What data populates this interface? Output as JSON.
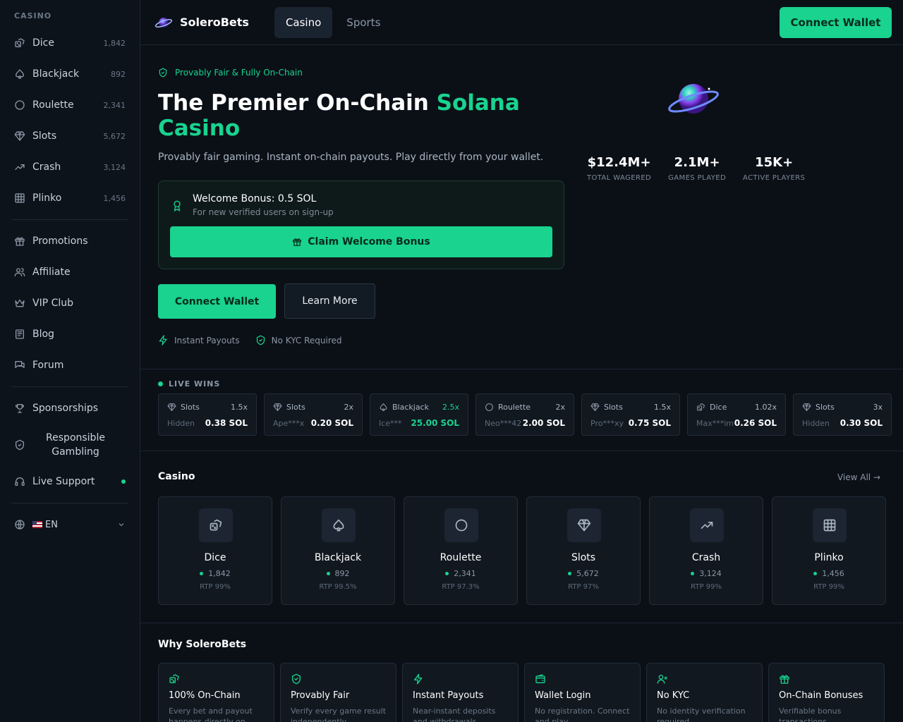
{
  "sidebar": {
    "section_label": "CASINO",
    "games": [
      {
        "label": "Dice",
        "count": "1,842",
        "icon": "dice-icon"
      },
      {
        "label": "Blackjack",
        "count": "892",
        "icon": "spade-icon"
      },
      {
        "label": "Roulette",
        "count": "2,341",
        "icon": "circle-icon"
      },
      {
        "label": "Slots",
        "count": "5,672",
        "icon": "diamond-icon"
      },
      {
        "label": "Crash",
        "count": "3,124",
        "icon": "trending-up-icon"
      },
      {
        "label": "Plinko",
        "count": "1,456",
        "icon": "grid-icon"
      }
    ],
    "links": [
      {
        "label": "Promotions",
        "icon": "gift-icon"
      },
      {
        "label": "Affiliate",
        "icon": "users-icon"
      },
      {
        "label": "VIP Club",
        "icon": "crown-icon"
      },
      {
        "label": "Blog",
        "icon": "newspaper-icon"
      },
      {
        "label": "Forum",
        "icon": "chat-icon"
      }
    ],
    "sponsorships": "Sponsorships",
    "responsible_gambling": "Responsible Gambling",
    "live_support": "Live Support",
    "language": "EN"
  },
  "topbar": {
    "brand": "SoleroBets",
    "tabs": [
      "Casino",
      "Sports"
    ],
    "active_tab": "Casino",
    "connect_wallet": "Connect Wallet"
  },
  "hero": {
    "badge": "Provably Fair & Fully On-Chain",
    "title_part1": "The Premier On-Chain ",
    "title_accent": "Solana Casino",
    "subtitle": "Provably fair gaming. Instant on-chain payouts. Play directly from your wallet.",
    "bonus_title": "Welcome Bonus: 0.5 SOL",
    "bonus_sub": "For new verified users on sign-up",
    "claim_label": "Claim Welcome Bonus",
    "connect_label": "Connect Wallet",
    "learn_label": "Learn More",
    "feature1": "Instant Payouts",
    "feature2": "No KYC Required",
    "stats": [
      {
        "value": "$12.4M+",
        "label": "TOTAL WAGERED"
      },
      {
        "value": "2.1M+",
        "label": "GAMES PLAYED"
      },
      {
        "value": "15K+",
        "label": "ACTIVE PLAYERS"
      }
    ]
  },
  "live_wins": {
    "heading": "LIVE WINS",
    "items": [
      {
        "game": "Slots",
        "mult": "1.5x",
        "user": "Hidden",
        "amount": "0.38 SOL",
        "icon": "diamond-icon",
        "highlight": false
      },
      {
        "game": "Slots",
        "mult": "2x",
        "user": "Ape***x",
        "amount": "0.20 SOL",
        "icon": "diamond-icon",
        "highlight": false
      },
      {
        "game": "Blackjack",
        "mult": "2.5x",
        "user": "Ice***",
        "amount": "25.00 SOL",
        "icon": "spade-icon",
        "highlight": true
      },
      {
        "game": "Roulette",
        "mult": "2x",
        "user": "Neo***42",
        "amount": "2.00 SOL",
        "icon": "circle-icon",
        "highlight": false
      },
      {
        "game": "Slots",
        "mult": "1.5x",
        "user": "Pro***xy",
        "amount": "0.75 SOL",
        "icon": "diamond-icon",
        "highlight": false
      },
      {
        "game": "Dice",
        "mult": "1.02x",
        "user": "Max***im",
        "amount": "0.26 SOL",
        "icon": "dice-icon",
        "highlight": false
      },
      {
        "game": "Slots",
        "mult": "3x",
        "user": "Hidden",
        "amount": "0.30 SOL",
        "icon": "diamond-icon",
        "highlight": false
      }
    ]
  },
  "casino": {
    "heading": "Casino",
    "view_all": "View All →",
    "games": [
      {
        "name": "Dice",
        "players": "1,842",
        "rtp": "RTP 99%",
        "icon": "dice-icon"
      },
      {
        "name": "Blackjack",
        "players": "892",
        "rtp": "RTP 99.5%",
        "icon": "spade-icon"
      },
      {
        "name": "Roulette",
        "players": "2,341",
        "rtp": "RTP 97.3%",
        "icon": "circle-icon"
      },
      {
        "name": "Slots",
        "players": "5,672",
        "rtp": "RTP 97%",
        "icon": "diamond-icon"
      },
      {
        "name": "Crash",
        "players": "3,124",
        "rtp": "RTP 99%",
        "icon": "trending-up-icon"
      },
      {
        "name": "Plinko",
        "players": "1,456",
        "rtp": "RTP 99%",
        "icon": "grid-icon"
      }
    ]
  },
  "why": {
    "heading": "Why SoleroBets",
    "features": [
      {
        "title": "100% On-Chain",
        "desc": "Every bet and payout happens directly on",
        "icon": "dice-icon"
      },
      {
        "title": "Provably Fair",
        "desc": "Verify every game result independently",
        "icon": "shield-check-icon"
      },
      {
        "title": "Instant Payouts",
        "desc": "Near-instant deposits and withdrawals",
        "icon": "lightning-icon"
      },
      {
        "title": "Wallet Login",
        "desc": "No registration. Connect and play",
        "icon": "wallet-icon"
      },
      {
        "title": "No KYC",
        "desc": "No identity verification required",
        "icon": "user-x-icon"
      },
      {
        "title": "On-Chain Bonuses",
        "desc": "Verifiable bonus transactions",
        "icon": "gift-icon"
      }
    ]
  },
  "colors": {
    "accent": "#19d38f",
    "bg": "#0b1017",
    "card": "#111820"
  }
}
